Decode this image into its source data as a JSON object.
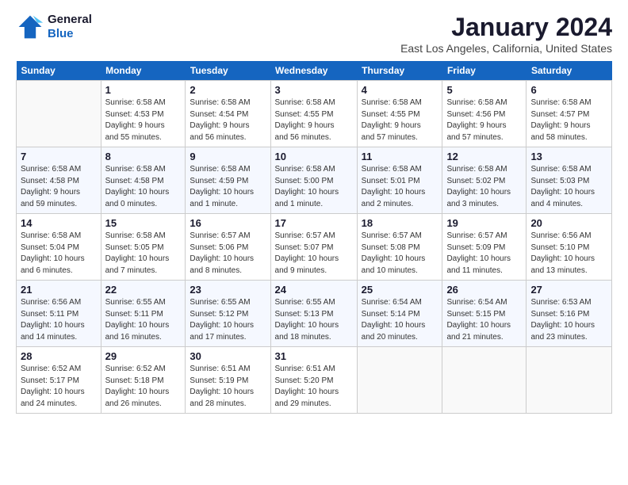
{
  "header": {
    "logo_line1": "General",
    "logo_line2": "Blue",
    "month": "January 2024",
    "location": "East Los Angeles, California, United States"
  },
  "weekdays": [
    "Sunday",
    "Monday",
    "Tuesday",
    "Wednesday",
    "Thursday",
    "Friday",
    "Saturday"
  ],
  "weeks": [
    [
      {
        "date": "",
        "info": ""
      },
      {
        "date": "1",
        "info": "Sunrise: 6:58 AM\nSunset: 4:53 PM\nDaylight: 9 hours\nand 55 minutes."
      },
      {
        "date": "2",
        "info": "Sunrise: 6:58 AM\nSunset: 4:54 PM\nDaylight: 9 hours\nand 56 minutes."
      },
      {
        "date": "3",
        "info": "Sunrise: 6:58 AM\nSunset: 4:55 PM\nDaylight: 9 hours\nand 56 minutes."
      },
      {
        "date": "4",
        "info": "Sunrise: 6:58 AM\nSunset: 4:55 PM\nDaylight: 9 hours\nand 57 minutes."
      },
      {
        "date": "5",
        "info": "Sunrise: 6:58 AM\nSunset: 4:56 PM\nDaylight: 9 hours\nand 57 minutes."
      },
      {
        "date": "6",
        "info": "Sunrise: 6:58 AM\nSunset: 4:57 PM\nDaylight: 9 hours\nand 58 minutes."
      }
    ],
    [
      {
        "date": "7",
        "info": "Sunrise: 6:58 AM\nSunset: 4:58 PM\nDaylight: 9 hours\nand 59 minutes."
      },
      {
        "date": "8",
        "info": "Sunrise: 6:58 AM\nSunset: 4:58 PM\nDaylight: 10 hours\nand 0 minutes."
      },
      {
        "date": "9",
        "info": "Sunrise: 6:58 AM\nSunset: 4:59 PM\nDaylight: 10 hours\nand 1 minute."
      },
      {
        "date": "10",
        "info": "Sunrise: 6:58 AM\nSunset: 5:00 PM\nDaylight: 10 hours\nand 1 minute."
      },
      {
        "date": "11",
        "info": "Sunrise: 6:58 AM\nSunset: 5:01 PM\nDaylight: 10 hours\nand 2 minutes."
      },
      {
        "date": "12",
        "info": "Sunrise: 6:58 AM\nSunset: 5:02 PM\nDaylight: 10 hours\nand 3 minutes."
      },
      {
        "date": "13",
        "info": "Sunrise: 6:58 AM\nSunset: 5:03 PM\nDaylight: 10 hours\nand 4 minutes."
      }
    ],
    [
      {
        "date": "14",
        "info": "Sunrise: 6:58 AM\nSunset: 5:04 PM\nDaylight: 10 hours\nand 6 minutes."
      },
      {
        "date": "15",
        "info": "Sunrise: 6:58 AM\nSunset: 5:05 PM\nDaylight: 10 hours\nand 7 minutes."
      },
      {
        "date": "16",
        "info": "Sunrise: 6:57 AM\nSunset: 5:06 PM\nDaylight: 10 hours\nand 8 minutes."
      },
      {
        "date": "17",
        "info": "Sunrise: 6:57 AM\nSunset: 5:07 PM\nDaylight: 10 hours\nand 9 minutes."
      },
      {
        "date": "18",
        "info": "Sunrise: 6:57 AM\nSunset: 5:08 PM\nDaylight: 10 hours\nand 10 minutes."
      },
      {
        "date": "19",
        "info": "Sunrise: 6:57 AM\nSunset: 5:09 PM\nDaylight: 10 hours\nand 11 minutes."
      },
      {
        "date": "20",
        "info": "Sunrise: 6:56 AM\nSunset: 5:10 PM\nDaylight: 10 hours\nand 13 minutes."
      }
    ],
    [
      {
        "date": "21",
        "info": "Sunrise: 6:56 AM\nSunset: 5:11 PM\nDaylight: 10 hours\nand 14 minutes."
      },
      {
        "date": "22",
        "info": "Sunrise: 6:55 AM\nSunset: 5:11 PM\nDaylight: 10 hours\nand 16 minutes."
      },
      {
        "date": "23",
        "info": "Sunrise: 6:55 AM\nSunset: 5:12 PM\nDaylight: 10 hours\nand 17 minutes."
      },
      {
        "date": "24",
        "info": "Sunrise: 6:55 AM\nSunset: 5:13 PM\nDaylight: 10 hours\nand 18 minutes."
      },
      {
        "date": "25",
        "info": "Sunrise: 6:54 AM\nSunset: 5:14 PM\nDaylight: 10 hours\nand 20 minutes."
      },
      {
        "date": "26",
        "info": "Sunrise: 6:54 AM\nSunset: 5:15 PM\nDaylight: 10 hours\nand 21 minutes."
      },
      {
        "date": "27",
        "info": "Sunrise: 6:53 AM\nSunset: 5:16 PM\nDaylight: 10 hours\nand 23 minutes."
      }
    ],
    [
      {
        "date": "28",
        "info": "Sunrise: 6:52 AM\nSunset: 5:17 PM\nDaylight: 10 hours\nand 24 minutes."
      },
      {
        "date": "29",
        "info": "Sunrise: 6:52 AM\nSunset: 5:18 PM\nDaylight: 10 hours\nand 26 minutes."
      },
      {
        "date": "30",
        "info": "Sunrise: 6:51 AM\nSunset: 5:19 PM\nDaylight: 10 hours\nand 28 minutes."
      },
      {
        "date": "31",
        "info": "Sunrise: 6:51 AM\nSunset: 5:20 PM\nDaylight: 10 hours\nand 29 minutes."
      },
      {
        "date": "",
        "info": ""
      },
      {
        "date": "",
        "info": ""
      },
      {
        "date": "",
        "info": ""
      }
    ]
  ]
}
